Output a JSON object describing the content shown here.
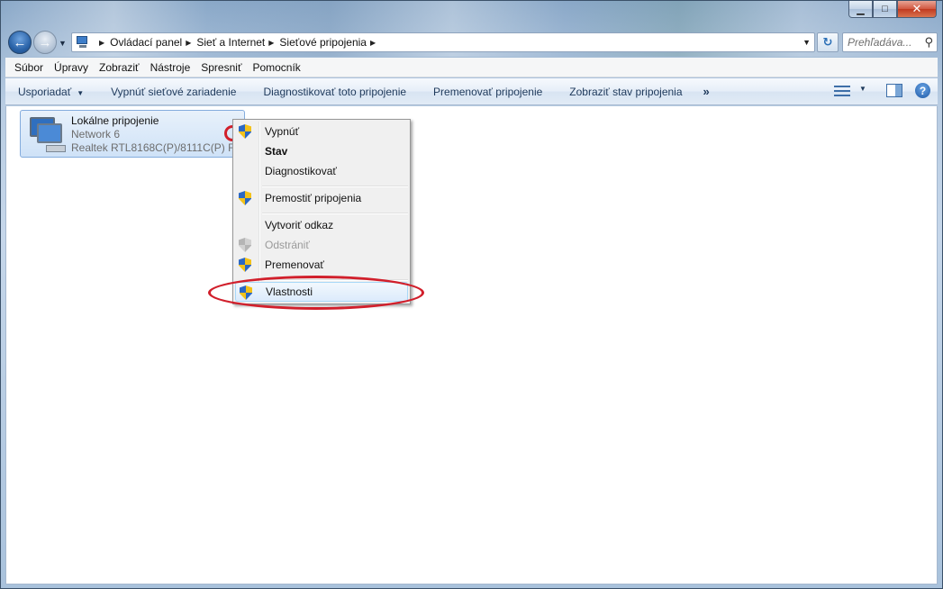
{
  "window": {
    "caption": {
      "minimize": "▁",
      "maximize": "□",
      "close": "✕"
    }
  },
  "address_bar": {
    "crumbs": [
      "Ovládací panel",
      "Sieť a Internet",
      "Sieťové pripojenia"
    ],
    "search_placeholder": "Prehľadáva..."
  },
  "menubar": {
    "items": [
      "Súbor",
      "Úpravy",
      "Zobraziť",
      "Nástroje",
      "Spresniť",
      "Pomocník"
    ]
  },
  "commandbar": {
    "organize": "Usporiadať",
    "disable": "Vypnúť sieťové zariadenie",
    "diagnose": "Diagnostikovať toto pripojenie",
    "rename": "Premenovať pripojenie",
    "status": "Zobraziť stav pripojenia",
    "more": "»"
  },
  "connection": {
    "name": "Lokálne pripojenie",
    "network": "Network  6",
    "adapter": "Realtek RTL8168C(P)/8111C(P) Fa..."
  },
  "context_menu": {
    "items": [
      {
        "label": "Vypnúť",
        "icon": "uac-shield-icon"
      },
      {
        "label": "Stav",
        "default": true
      },
      {
        "label": "Diagnostikovať"
      },
      {
        "label": "Premostiť pripojenia",
        "icon": "uac-shield-icon"
      },
      {
        "label": "Vytvoriť odkaz"
      },
      {
        "label": "Odstrániť",
        "icon": "uac-shield-icon",
        "disabled": true
      },
      {
        "label": "Premenovať",
        "icon": "uac-shield-icon"
      },
      {
        "label": "Vlastnosti",
        "icon": "uac-shield-icon",
        "highlighted": true
      }
    ]
  },
  "annotations": {
    "color": "#d11f2b"
  }
}
